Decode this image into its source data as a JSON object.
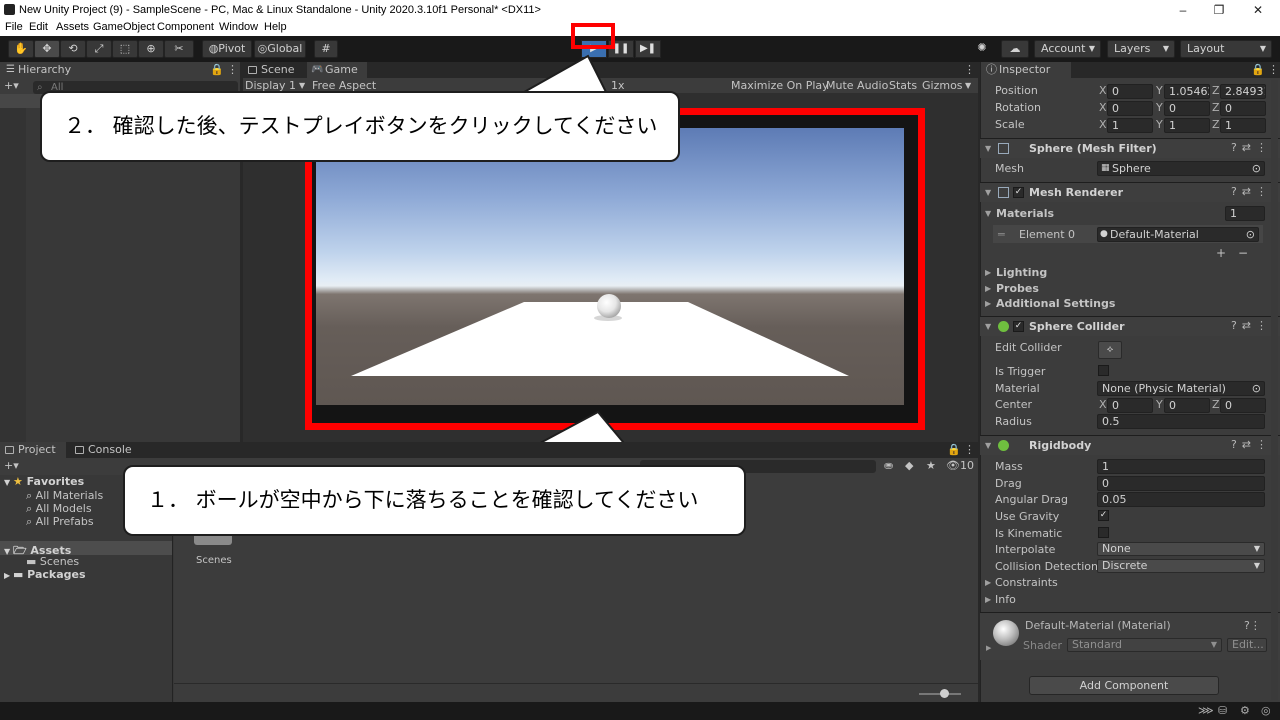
{
  "window": {
    "title": "New Unity Project (9) - SampleScene - PC, Mac & Linux Standalone - Unity 2020.3.10f1 Personal* <DX11>",
    "minimize": "–",
    "maximize": "❐",
    "close": "✕"
  },
  "menu": [
    "File",
    "Edit",
    "Assets",
    "GameObject",
    "Component",
    "Window",
    "Help"
  ],
  "toolbar": {
    "pivot": "Pivot",
    "global": "Global",
    "play": "▶",
    "pause": "❚❚",
    "step": "▶❚",
    "account": "Account",
    "layers": "Layers",
    "layout": "Layout"
  },
  "hierarchy": {
    "tab": "Hierarchy",
    "add": "+▾",
    "search_placeholder": "All"
  },
  "scene_tabs": {
    "scene": "Scene",
    "game": "Game"
  },
  "game_toolbar": {
    "display": "Display 1",
    "aspect": "Free Aspect",
    "scale": "1x",
    "maximize": "Maximize On Play",
    "mute": "Mute Audio",
    "stats": "Stats",
    "gizmos": "Gizmos"
  },
  "annotations": {
    "step2": "２． 確認した後、テストプレイボタンをクリックしてください",
    "step1": "１． ボールが空中から下に落ちることを確認してください",
    "highlight_color": "#ff0000"
  },
  "project": {
    "tab_project": "Project",
    "tab_console": "Console",
    "add": "+▾",
    "hidden_count": "10",
    "favorites": "Favorites",
    "fav_items": [
      "All Materials",
      "All Models",
      "All Prefabs"
    ],
    "assets": "Assets",
    "scenes": "Scenes",
    "packages": "Packages",
    "folder_label": "Scenes"
  },
  "inspector": {
    "tab": "Inspector",
    "transform": {
      "position_label": "Position",
      "rotation_label": "Rotation",
      "scale_label": "Scale",
      "position": {
        "x": "0",
        "y": "1.05462",
        "z": "2.84931"
      },
      "rotation": {
        "x": "0",
        "y": "0",
        "z": "0"
      },
      "scale": {
        "x": "1",
        "y": "1",
        "z": "1"
      }
    },
    "mesh_filter": {
      "title": "Sphere (Mesh Filter)",
      "mesh_label": "Mesh",
      "mesh_value": "Sphere"
    },
    "mesh_renderer": {
      "title": "Mesh Renderer",
      "materials_label": "Materials",
      "materials_count": "1",
      "element_label": "Element 0",
      "element_value": "Default-Material",
      "lighting": "Lighting",
      "probes": "Probes",
      "additional": "Additional Settings"
    },
    "sphere_collider": {
      "title": "Sphere Collider",
      "edit_collider": "Edit Collider",
      "is_trigger": "Is Trigger",
      "material_label": "Material",
      "material_value": "None (Physic Material)",
      "center_label": "Center",
      "center": {
        "x": "0",
        "y": "0",
        "z": "0"
      },
      "radius_label": "Radius",
      "radius": "0.5"
    },
    "rigidbody": {
      "title": "Rigidbody",
      "mass_label": "Mass",
      "mass": "1",
      "drag_label": "Drag",
      "drag": "0",
      "angular_drag_label": "Angular Drag",
      "angular_drag": "0.05",
      "use_gravity_label": "Use Gravity",
      "is_kinematic_label": "Is Kinematic",
      "interpolate_label": "Interpolate",
      "interpolate": "None",
      "collision_label": "Collision Detection",
      "collision": "Discrete",
      "constraints": "Constraints",
      "info": "Info"
    },
    "material": {
      "title": "Default-Material (Material)",
      "shader_label": "Shader",
      "shader_value": "Standard",
      "edit": "Edit..."
    },
    "add_component": "Add Component"
  }
}
